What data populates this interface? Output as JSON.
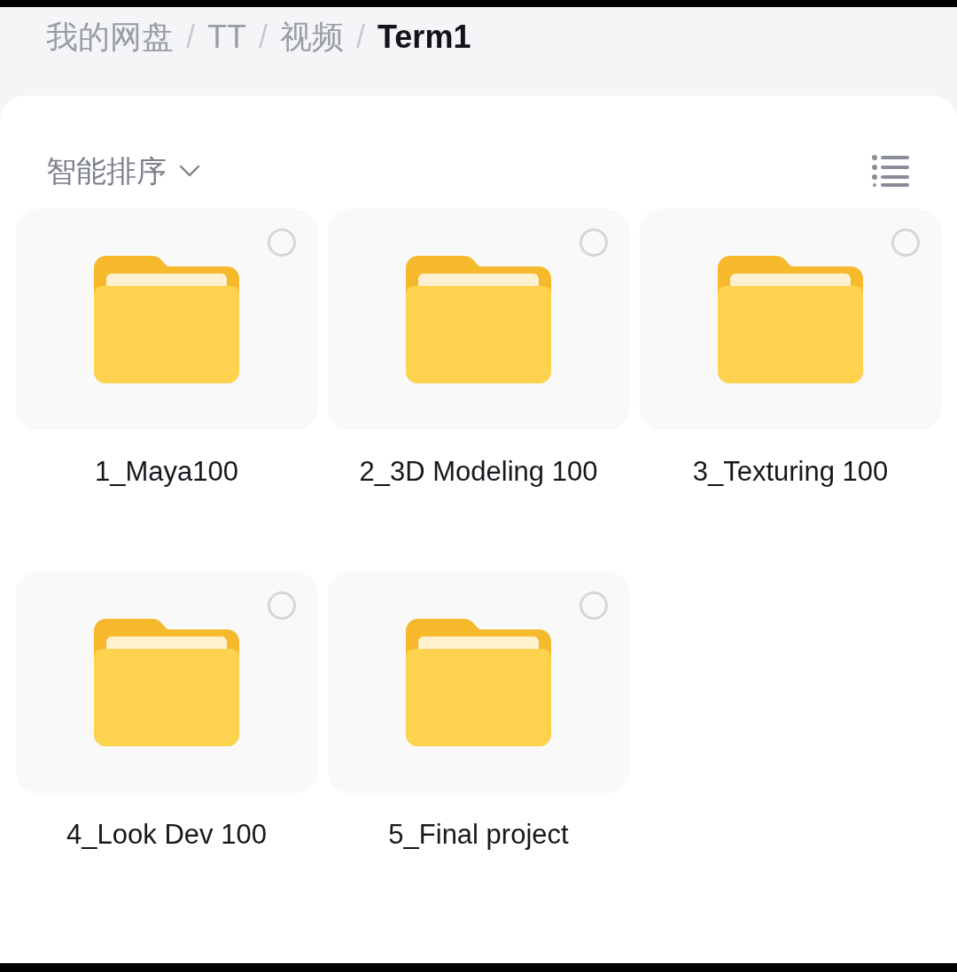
{
  "breadcrumb": [
    {
      "label": "我的网盘",
      "current": false
    },
    {
      "label": "TT",
      "current": false
    },
    {
      "label": "视频",
      "current": false
    },
    {
      "label": "Term1",
      "current": true
    }
  ],
  "breadcrumb_separator": "/",
  "sort": {
    "label": "智能排序"
  },
  "folders": [
    {
      "name": "1_Maya100",
      "selected": false
    },
    {
      "name": "2_3D Modeling 100",
      "selected": false
    },
    {
      "name": "3_Texturing 100",
      "selected": false
    },
    {
      "name": "4_Look Dev 100",
      "selected": false
    },
    {
      "name": "5_Final project",
      "selected": false
    }
  ]
}
